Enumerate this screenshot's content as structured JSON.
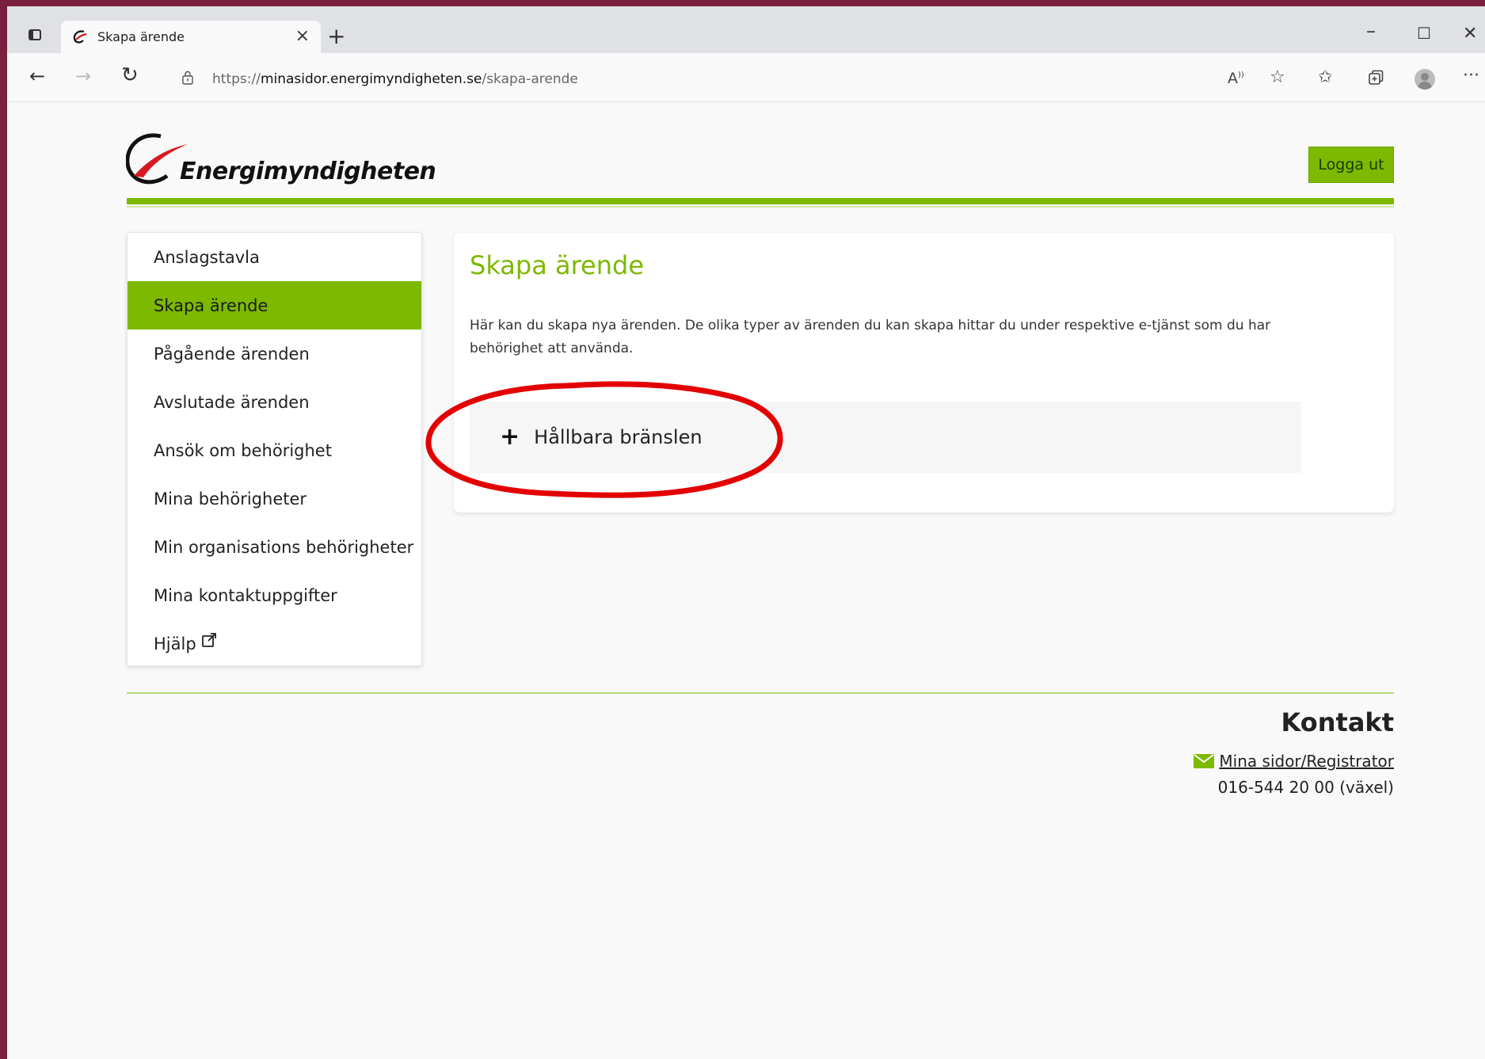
{
  "browser": {
    "tab_title": "Skapa ärende",
    "tab_close": "×",
    "new_tab": "+",
    "url_prefix": "https://",
    "url_domain": "minasidor.energimyndigheten.se",
    "url_path": "/skapa-arende",
    "win_min": "–",
    "win_max": "☐",
    "win_close": "✕",
    "icons": [
      "read-aloud-icon",
      "favorite-add-icon",
      "favorites-icon",
      "collections-icon",
      "profile-icon",
      "more-icon"
    ]
  },
  "header": {
    "logo_text": "Energimyndigheten",
    "logout_label": "Logga ut"
  },
  "sidebar": {
    "items": [
      {
        "label": "Anslagstavla",
        "active": false
      },
      {
        "label": "Skapa ärende",
        "active": true
      },
      {
        "label": "Pågående ärenden",
        "active": false
      },
      {
        "label": "Avslutade ärenden",
        "active": false
      },
      {
        "label": "Ansök om behörighet",
        "active": false
      },
      {
        "label": "Mina behörigheter",
        "active": false
      },
      {
        "label": "Min organisations behörigheter",
        "active": false
      },
      {
        "label": "Mina kontaktuppgifter",
        "active": false
      },
      {
        "label": "Hjälp",
        "active": false
      }
    ]
  },
  "main": {
    "title": "Skapa ärende",
    "description": "Här kan du skapa nya ärenden. De olika typer av ärenden du kan skapa hittar du under respektive e-tjänst som du har behörighet att använda.",
    "accordion_label": "Hållbara bränslen"
  },
  "footer": {
    "contact_title": "Kontakt",
    "contact_link": "Mina sidor/Registrator",
    "contact_phone": "016-544 20 00 (växel)"
  },
  "colors": {
    "brand_green": "#7cb900",
    "logo_red": "#d71920",
    "annotation_red": "#e30000"
  }
}
